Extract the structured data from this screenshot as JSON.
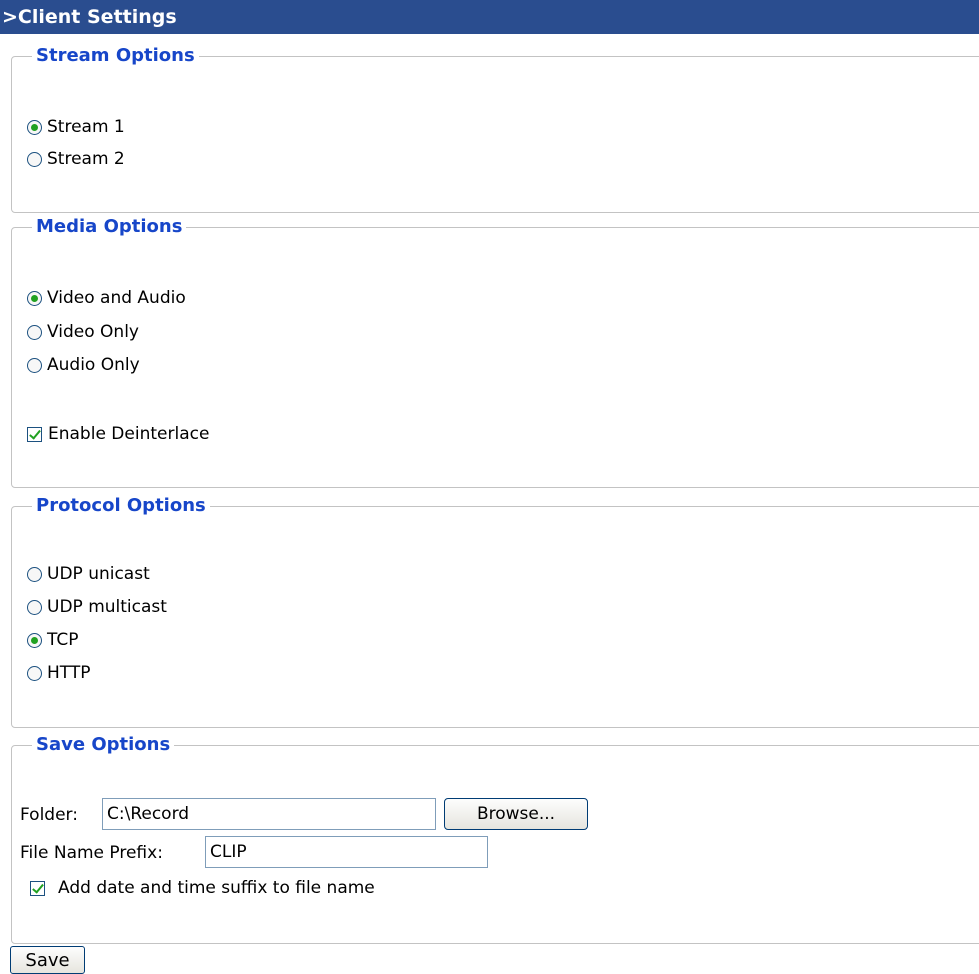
{
  "header": {
    "title": ">Client Settings"
  },
  "stream_options": {
    "legend": "Stream Options",
    "selected": "Stream 1",
    "options": [
      {
        "label": "Stream 1",
        "checked": true
      },
      {
        "label": "Stream 2",
        "checked": false
      }
    ]
  },
  "media_options": {
    "legend": "Media Options",
    "selected": "Video and Audio",
    "options": [
      {
        "label": "Video and Audio",
        "checked": true
      },
      {
        "label": "Video Only",
        "checked": false
      },
      {
        "label": "Audio Only",
        "checked": false
      }
    ],
    "deinterlace": {
      "label": "Enable Deinterlace",
      "checked": true
    }
  },
  "protocol_options": {
    "legend": "Protocol Options",
    "selected": "TCP",
    "options": [
      {
        "label": "UDP unicast",
        "checked": false
      },
      {
        "label": "UDP multicast",
        "checked": false
      },
      {
        "label": "TCP",
        "checked": true
      },
      {
        "label": "HTTP",
        "checked": false
      }
    ]
  },
  "save_options": {
    "legend": "Save Options",
    "folder_label": "Folder:",
    "folder_value": "C:\\Record",
    "browse_label": "Browse...",
    "prefix_label": "File Name Prefix:",
    "prefix_value": "CLIP",
    "suffix": {
      "label": "Add date and time suffix to file name",
      "checked": true
    }
  },
  "save_button": {
    "label": "Save"
  },
  "colors": {
    "header_bg": "#2a4d8f",
    "legend_text": "#1746c9",
    "radio_dot": "#21a121",
    "check_mark": "#21a121",
    "group_border": "#c3c3c3"
  }
}
